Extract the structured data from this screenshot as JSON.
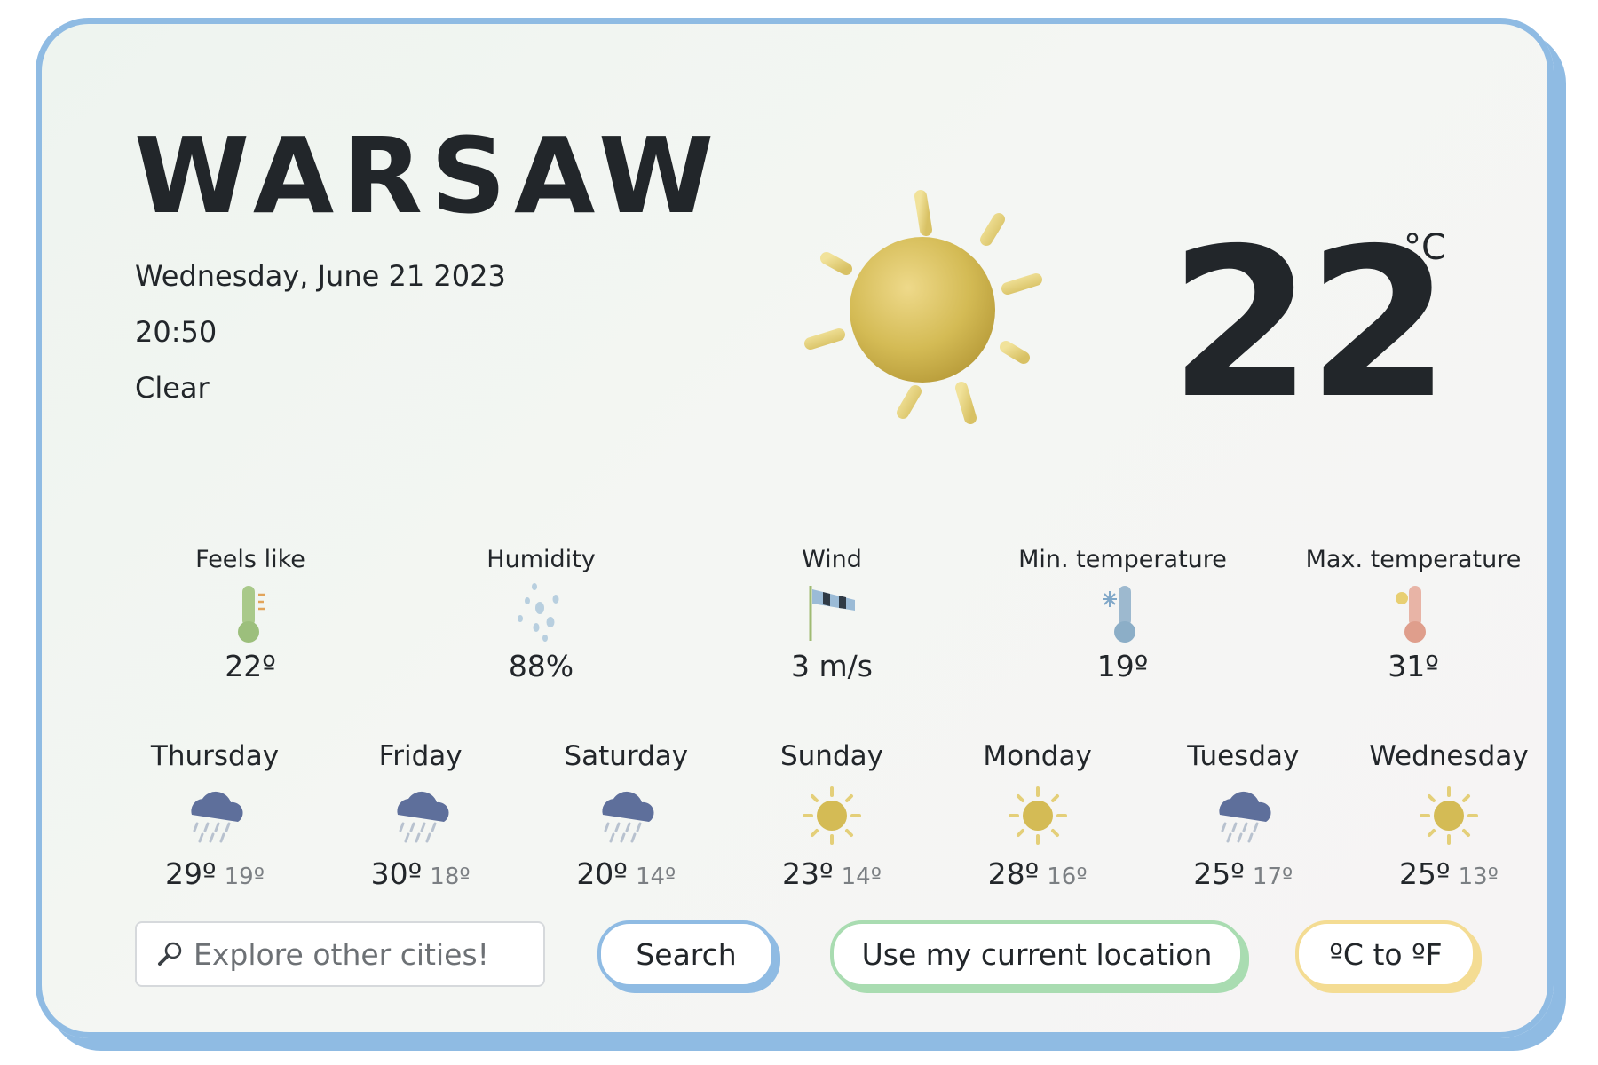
{
  "city": "WARSAW",
  "date": "Wednesday, June 21 2023",
  "time": "20:50",
  "condition": "Clear",
  "current": {
    "icon": "sun-icon",
    "temperature": "22",
    "unit": "°C"
  },
  "stats": [
    {
      "label": "Feels like",
      "value": "22º",
      "icon": "thermometer-icon"
    },
    {
      "label": "Humidity",
      "value": "88%",
      "icon": "droplets-icon"
    },
    {
      "label": "Wind",
      "value": "3 m/s",
      "icon": "windsock-icon"
    },
    {
      "label": "Min. temperature",
      "value": "19º",
      "icon": "cold-thermometer-icon"
    },
    {
      "label": "Max. temperature",
      "value": "31º",
      "icon": "hot-thermometer-icon"
    }
  ],
  "forecast": [
    {
      "day": "Thursday",
      "max": "29º",
      "min": "19º",
      "icon": "rain-cloud-icon"
    },
    {
      "day": "Friday",
      "max": "30º",
      "min": "18º",
      "icon": "rain-cloud-icon"
    },
    {
      "day": "Saturday",
      "max": "20º",
      "min": "14º",
      "icon": "rain-cloud-icon"
    },
    {
      "day": "Sunday",
      "max": "23º",
      "min": "14º",
      "icon": "sun-icon"
    },
    {
      "day": "Monday",
      "max": "28º",
      "min": "16º",
      "icon": "sun-icon"
    },
    {
      "day": "Tuesday",
      "max": "25º",
      "min": "17º",
      "icon": "rain-cloud-icon"
    },
    {
      "day": "Wednesday",
      "max": "25º",
      "min": "13º",
      "icon": "sun-icon"
    }
  ],
  "controls": {
    "search_placeholder": "Explore other cities!",
    "search_label": "Search",
    "location_label": "Use my current location",
    "unit_toggle_label": "ºC to ºF"
  },
  "colors": {
    "card_border": "#8fbbe3",
    "location_border": "#a9dcb1",
    "unit_border": "#f4dc93",
    "sun": "#d4bb55",
    "text": "#22262a"
  }
}
